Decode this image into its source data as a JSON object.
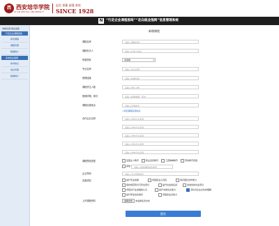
{
  "header": {
    "logo_seal": "西",
    "logo_name": "西安培华学院",
    "logo_en": "XI'AN PEIHUA UNIVERSITY",
    "logo_motto": "自主 求真 自强 求实",
    "logo_since": "SINCE 1928",
    "banner_title": "“行走企业课程思政”“走向就业强网”信息管理系统",
    "brand_color": "#9e1b1b"
  },
  "sidebar": {
    "top_text": "当前位置:信息采集",
    "groups": [
      {
        "head": "行走企业课程思政",
        "items": [
          "新增课程",
          "课程管理",
          "数据统计"
        ]
      },
      {
        "head": "走向就业强网",
        "items": [
          "新增信息",
          "信息管理",
          "数据统计"
        ]
      }
    ]
  },
  "main": {
    "page_title": "新增课程",
    "fields": [
      {
        "label": "课程名称",
        "placeholder": "请输入课程名称"
      },
      {
        "label": "课程负责人",
        "placeholder": "请输入负责人姓名"
      },
      {
        "label": "所属院系",
        "value": "请选择"
      },
      {
        "label": "专业名称",
        "placeholder": "请输入专业名称"
      },
      {
        "label": "授课班级",
        "placeholder": "请输入授课班级"
      },
      {
        "label": "课程学生人数",
        "placeholder": "请输入学生人数"
      },
      {
        "label": "授课学期、周次",
        "placeholder": "请输入授课学期、周次"
      },
      {
        "label": "课程实施地点",
        "placeholder": "请输入实施地点"
      }
    ],
    "add_link": "+添加课程实施地点",
    "enterprise_label": "合作企业名称",
    "enterprise_inputs": [
      "请输入合作企业名称",
      "请输入合作企业名称",
      "请输入合作企业名称",
      "请输入合作企业名称",
      "请输入合作企业名称"
    ],
    "type_label": "课程思政类型",
    "type_options": [
      "爱国主义教育",
      "职业道德教育",
      "工匠精神教育",
      "劳动教育实践"
    ],
    "other_label": "其他",
    "other_placeholder": "请输入其他课程思政类型",
    "teacher_label": "企业导师",
    "teacher_placeholder": "请输入企业导师姓名",
    "effect_label": "实施成效",
    "effect_options": [
      "提升专业技能",
      "增强职业认同感",
      "培养团队协作能力",
      "强化规范意识与安全意识",
      "提升社会责任感",
      "激发创新创业意识",
      "增强对行业发展的认识",
      "提升沟通表达能力",
      "深化对企业文化的理解",
      "提升学生综合素养",
      "增强就业竞争力"
    ],
    "file_label": "上传课程资料",
    "file_button": "选择文件",
    "file_status": "未选择任何文件",
    "submit_label": "提交"
  }
}
